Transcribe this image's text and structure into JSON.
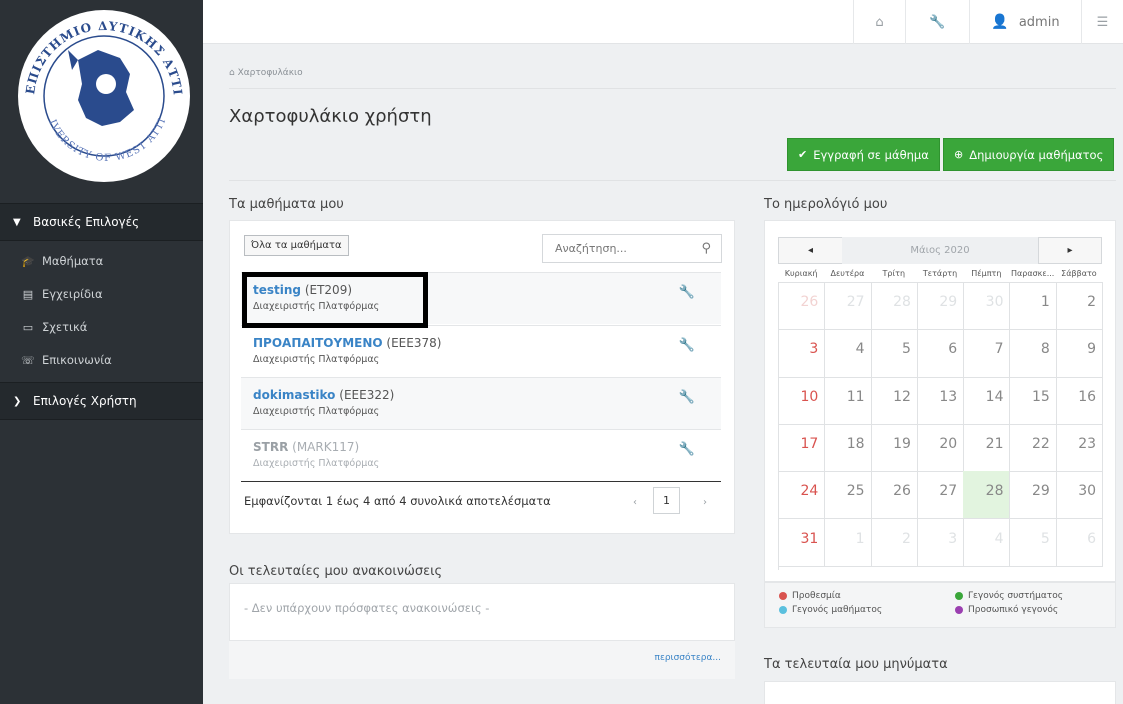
{
  "topbar": {
    "home_icon": "home-icon",
    "wrench_icon": "wrench-icon",
    "user": "admin",
    "settings_icon": "sliders-icon"
  },
  "sidebar": {
    "logo_text_top": "ΠΑΝΕΠΙΣΤΗΜΙΟ ΔΥΤΙΚΗΣ ΑΤΤΙΚΗΣ",
    "logo_text_bottom": "UNIVERSITY OF WEST ATTICA",
    "main_heading": "Βασικές Επιλογές",
    "items": [
      {
        "label": "Μαθήματα",
        "icon": "graduation-cap-icon"
      },
      {
        "label": "Εγχειρίδια",
        "icon": "file-icon"
      },
      {
        "label": "Σχετικά",
        "icon": "card-icon"
      },
      {
        "label": "Επικοινωνία",
        "icon": "phone-icon"
      }
    ],
    "user_heading": "Επιλογές Χρήστη"
  },
  "breadcrumb": "Χαρτοφυλάκιο",
  "page_title": "Χαρτοφυλάκιο χρήστη",
  "actions": {
    "enroll": "Εγγραφή σε μάθημα",
    "create": "Δημιουργία μαθήματος"
  },
  "courses": {
    "title": "Τα μαθήματα μου",
    "all_button": "Όλα τα μαθήματα",
    "search_placeholder": "Αναζήτηση...",
    "rows": [
      {
        "name": "testing",
        "code": "(ET209)",
        "role": "Διαχειριστής Πλατφόρμας"
      },
      {
        "name": "ΠΡΟΑΠΑΙΤΟΥΜΕΝΟ",
        "code": "(EEE378)",
        "role": "Διαχειριστής Πλατφόρμας"
      },
      {
        "name": "dokimastiko",
        "code": "(EEE322)",
        "role": "Διαχειριστής Πλατφόρμας"
      },
      {
        "name": "STRR",
        "code": "(MARK117)",
        "role": "Διαχειριστής Πλατφόρμας"
      }
    ],
    "results": "Εμφανίζονται 1 έως 4 από 4 συνολικά αποτελέσματα",
    "page": "1",
    "prev": "‹",
    "next": "›"
  },
  "announcements": {
    "title": "Οι τελευταίες μου ανακοινώσεις",
    "empty": "- Δεν υπάρχουν πρόσφατες ανακοινώσεις -",
    "more": "περισσότερα..."
  },
  "calendar": {
    "title": "Το ημερολόγιό μου",
    "month": "Μάιος 2020",
    "prev": "◂",
    "next": "▸",
    "days": [
      "Κυριακή",
      "Δευτέρα",
      "Τρίτη",
      "Τετάρτη",
      "Πέμπτη",
      "Παρασκε...",
      "Σάββατο"
    ],
    "weeks": [
      [
        "26",
        "27",
        "28",
        "29",
        "30",
        "1",
        "2"
      ],
      [
        "3",
        "4",
        "5",
        "6",
        "7",
        "8",
        "9"
      ],
      [
        "10",
        "11",
        "12",
        "13",
        "14",
        "15",
        "16"
      ],
      [
        "17",
        "18",
        "19",
        "20",
        "21",
        "22",
        "23"
      ],
      [
        "24",
        "25",
        "26",
        "27",
        "28",
        "29",
        "30"
      ],
      [
        "31",
        "1",
        "2",
        "3",
        "4",
        "5",
        "6"
      ]
    ],
    "today": "28",
    "legend": [
      {
        "label": "Προθεσμία",
        "color": "#d9534f"
      },
      {
        "label": "Γεγονός συστήματος",
        "color": "#3aa63a"
      },
      {
        "label": "Γεγονός μαθήματος",
        "color": "#5bc0de"
      },
      {
        "label": "Προσωπικό γεγονός",
        "color": "#9b3fb0"
      }
    ]
  },
  "messages": {
    "title": "Τα τελευταία μου μηνύματα"
  }
}
